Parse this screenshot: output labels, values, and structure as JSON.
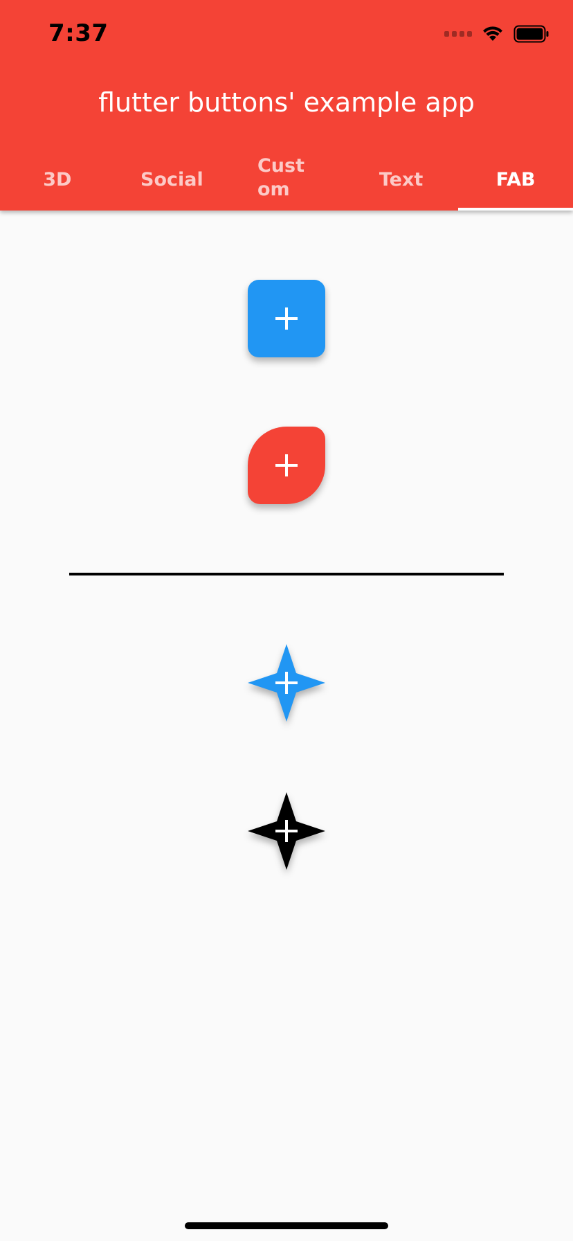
{
  "status_bar": {
    "time": "7:37",
    "signal_icon": "cellular-signal-icon",
    "wifi_icon": "wifi-icon",
    "battery_icon": "battery-icon"
  },
  "app_bar": {
    "title": "flutter buttons' example app",
    "background_color": "#f44336"
  },
  "tabs": [
    {
      "label": "3D",
      "active": false
    },
    {
      "label": "Social",
      "active": false
    },
    {
      "label": "Custom",
      "active": false
    },
    {
      "label": "Text",
      "active": false
    },
    {
      "label": "FAB",
      "active": true
    }
  ],
  "fab_buttons": [
    {
      "name": "square-fab",
      "color": "#2196f3",
      "shape": "rounded-square",
      "icon": "plus-icon"
    },
    {
      "name": "leaf-fab",
      "color": "#f44336",
      "shape": "leaf",
      "icon": "plus-icon"
    },
    {
      "name": "star-fab-blue",
      "color": "#2196f3",
      "shape": "four-point-star",
      "icon": "plus-icon"
    },
    {
      "name": "star-fab-black",
      "color": "#000000",
      "shape": "four-point-star",
      "icon": "plus-icon"
    }
  ]
}
